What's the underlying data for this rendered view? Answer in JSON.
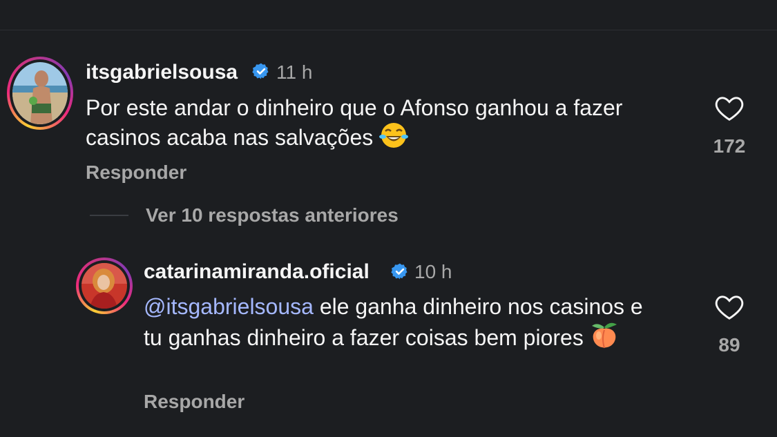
{
  "comments": [
    {
      "username": "itsgabrielsousa",
      "time": "11 h",
      "text": "Por este andar o dinheiro que o Afonso ganhou a fazer casinos acaba nas salvações",
      "emoji": "face-with-tears-of-joy",
      "likes": "172",
      "reply_label": "Responder"
    },
    {
      "username": "catarinamiranda.oficial",
      "time": "10 h",
      "mention": "@itsgabrielsousa",
      "text": "ele ganha dinheiro nos casinos e tu ganhas dinheiro a fazer coisas bem piores",
      "emoji": "peach",
      "likes": "89",
      "reply_label": "Responder"
    }
  ],
  "view_replies_label": "Ver 10 respostas anteriores",
  "icons": {
    "verified": "verified-badge-icon",
    "like": "heart-icon"
  },
  "colors": {
    "background": "#1c1e21",
    "verified": "#3897f0",
    "mention": "#a5b8ff",
    "secondary_text": "#a8a8a8"
  }
}
